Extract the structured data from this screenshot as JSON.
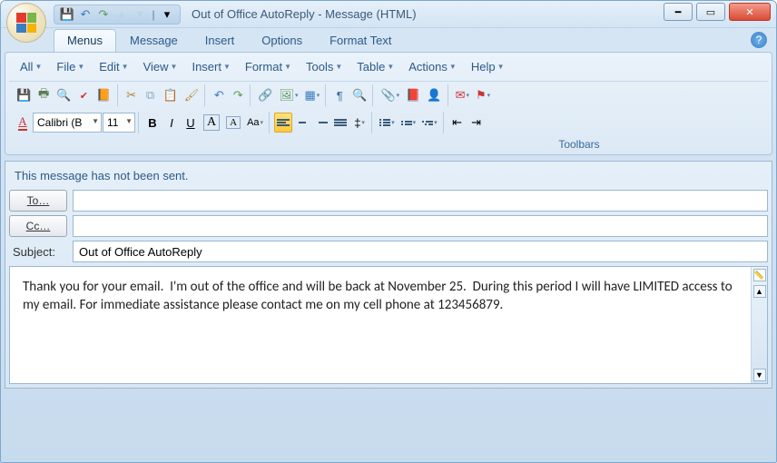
{
  "window": {
    "title": "Out of Office AutoReply - Message (HTML)"
  },
  "qat": {
    "save": "💾",
    "undo": "↶",
    "redo": "↷",
    "up": "▲",
    "down": "▼",
    "more": "▾"
  },
  "tabs": {
    "menus": "Menus",
    "message": "Message",
    "insert": "Insert",
    "options": "Options",
    "format_text": "Format Text"
  },
  "menus": {
    "all": "All",
    "file": "File",
    "edit": "Edit",
    "view": "View",
    "insert": "Insert",
    "format": "Format",
    "tools": "Tools",
    "table": "Table",
    "actions": "Actions",
    "help": "Help"
  },
  "font": {
    "name": "Calibri (B",
    "size": "11"
  },
  "toolbars_label": "Toolbars",
  "compose": {
    "notice": "This message has not been sent.",
    "to_label": "To…",
    "cc_label": "Cc…",
    "subject_label": "Subject:",
    "to_value": "",
    "cc_value": "",
    "subject_value": "Out of Office AutoReply",
    "body": "Thank you for your email.  I'm out of the office and will be back at November 25.  During this period I will have LIMITED access to my email. For immediate assistance please contact me on my cell phone at 123456879."
  }
}
